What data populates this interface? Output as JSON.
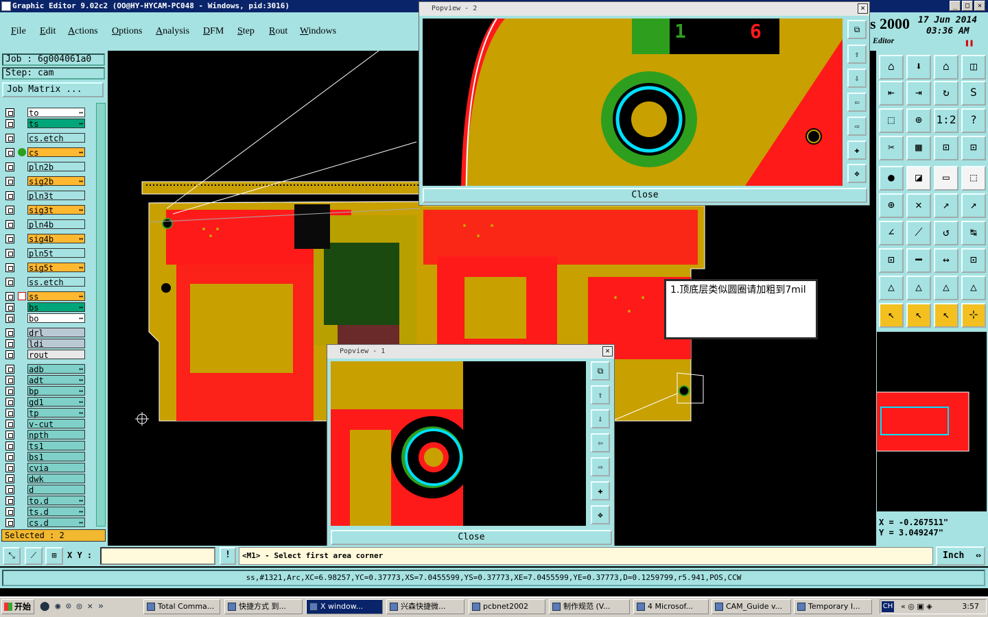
{
  "window": {
    "title": "Graphic Editor 9.02c2 (OO@HY-HYCAM-PC048 - Windows, pid:3016)",
    "product_fragment": "s 2000",
    "product_sub": "Editor",
    "date": "17 Jun 2014",
    "time": "03:36 AM"
  },
  "menu": [
    "File",
    "Edit",
    "Actions",
    "Options",
    "Analysis",
    "DFM",
    "Step",
    "Rout",
    "Windows"
  ],
  "job": {
    "job_label": "Job : 6g004061a0",
    "step_label": "Step: cam",
    "matrix_button": "Job Matrix ..."
  },
  "layers": [
    {
      "name": "to",
      "style": "white",
      "mark": "↔"
    },
    {
      "name": "ts",
      "style": "green",
      "mark": "↔"
    },
    {
      "name": "cs.etch",
      "style": "board",
      "mark": ""
    },
    {
      "name": "cs",
      "style": "sig",
      "mark": "↔"
    },
    {
      "name": "pln2b",
      "style": "board",
      "mark": ""
    },
    {
      "name": "sig2b",
      "style": "sig",
      "mark": "↔"
    },
    {
      "name": "pln3t",
      "style": "board",
      "mark": ""
    },
    {
      "name": "sig3t",
      "style": "sig",
      "mark": "↔"
    },
    {
      "name": "pln4b",
      "style": "board",
      "mark": ""
    },
    {
      "name": "sig4b",
      "style": "sig",
      "mark": "↔"
    },
    {
      "name": "pln5t",
      "style": "board",
      "mark": ""
    },
    {
      "name": "sig5t",
      "style": "sig",
      "mark": "↔"
    },
    {
      "name": "ss.etch",
      "style": "board",
      "mark": ""
    },
    {
      "name": "ss",
      "style": "sig",
      "mark": "↔"
    },
    {
      "name": "bs",
      "style": "green",
      "mark": "↔"
    },
    {
      "name": "bo",
      "style": "white",
      "mark": "↔"
    },
    {
      "name": "drl",
      "style": "grey",
      "mark": ""
    },
    {
      "name": "ldi",
      "style": "grey",
      "mark": ""
    },
    {
      "name": "rout",
      "style": "pale",
      "mark": ""
    },
    {
      "name": "adb",
      "style": "teal",
      "mark": "↔"
    },
    {
      "name": "adt",
      "style": "teal",
      "mark": "↔"
    },
    {
      "name": "bp",
      "style": "teal",
      "mark": "↔"
    },
    {
      "name": "gd1",
      "style": "teal",
      "mark": "↔"
    },
    {
      "name": "tp",
      "style": "teal",
      "mark": "↔"
    },
    {
      "name": "v-cut",
      "style": "teal",
      "mark": ""
    },
    {
      "name": "npth",
      "style": "teal",
      "mark": ""
    },
    {
      "name": "ts1",
      "style": "teal",
      "mark": ""
    },
    {
      "name": "bs1",
      "style": "teal",
      "mark": ""
    },
    {
      "name": "cvia",
      "style": "teal",
      "mark": ""
    },
    {
      "name": "dwk",
      "style": "teal",
      "mark": ""
    },
    {
      "name": "d",
      "style": "teal",
      "mark": ""
    },
    {
      "name": "to.d",
      "style": "teal",
      "mark": "↔"
    },
    {
      "name": "ts.d",
      "style": "teal",
      "mark": "↔"
    },
    {
      "name": "cs.d",
      "style": "teal",
      "mark": "↔"
    }
  ],
  "selected_label": "Selected : 2",
  "coords": {
    "x": "X = -0.267511\"",
    "y": "Y = 3.049247\""
  },
  "cmd": {
    "xy_label": "X Y :",
    "xy_value": "",
    "prompt": "<M1> - Select first area corner",
    "units": "Inch"
  },
  "status_line": "ss,#1321,Arc,XC=6.98257,YC=0.37773,XS=7.0455599,YS=0.37773,XE=7.0455599,YE=0.37773,D=0.1259799,r5.941,POS,CCW",
  "popview2": {
    "title": "Popview - 2",
    "close": "Close",
    "label_a": "1",
    "label_b": "6"
  },
  "popview1": {
    "title": "Popview - 1",
    "close": "Close"
  },
  "note": "1.顶底层类似圆圈请加粗到7mil",
  "taskbar": {
    "start": "开始",
    "items": [
      "Total Comma...",
      "快捷方式 到...",
      "X window...",
      "兴森快捷微...",
      "pcbnet2002",
      "制作规范 (V...",
      "4 Microsof...",
      "CAM_Guide v...",
      "Temporary I..."
    ],
    "active_index": 2,
    "lang": "CH",
    "clock": "3:57"
  },
  "colors": {
    "board": "#c8a000",
    "copper": "#ff1a1a",
    "panel": "#a6e2e2",
    "green": "#2e9e1e",
    "cyan": "#00e0ff"
  }
}
